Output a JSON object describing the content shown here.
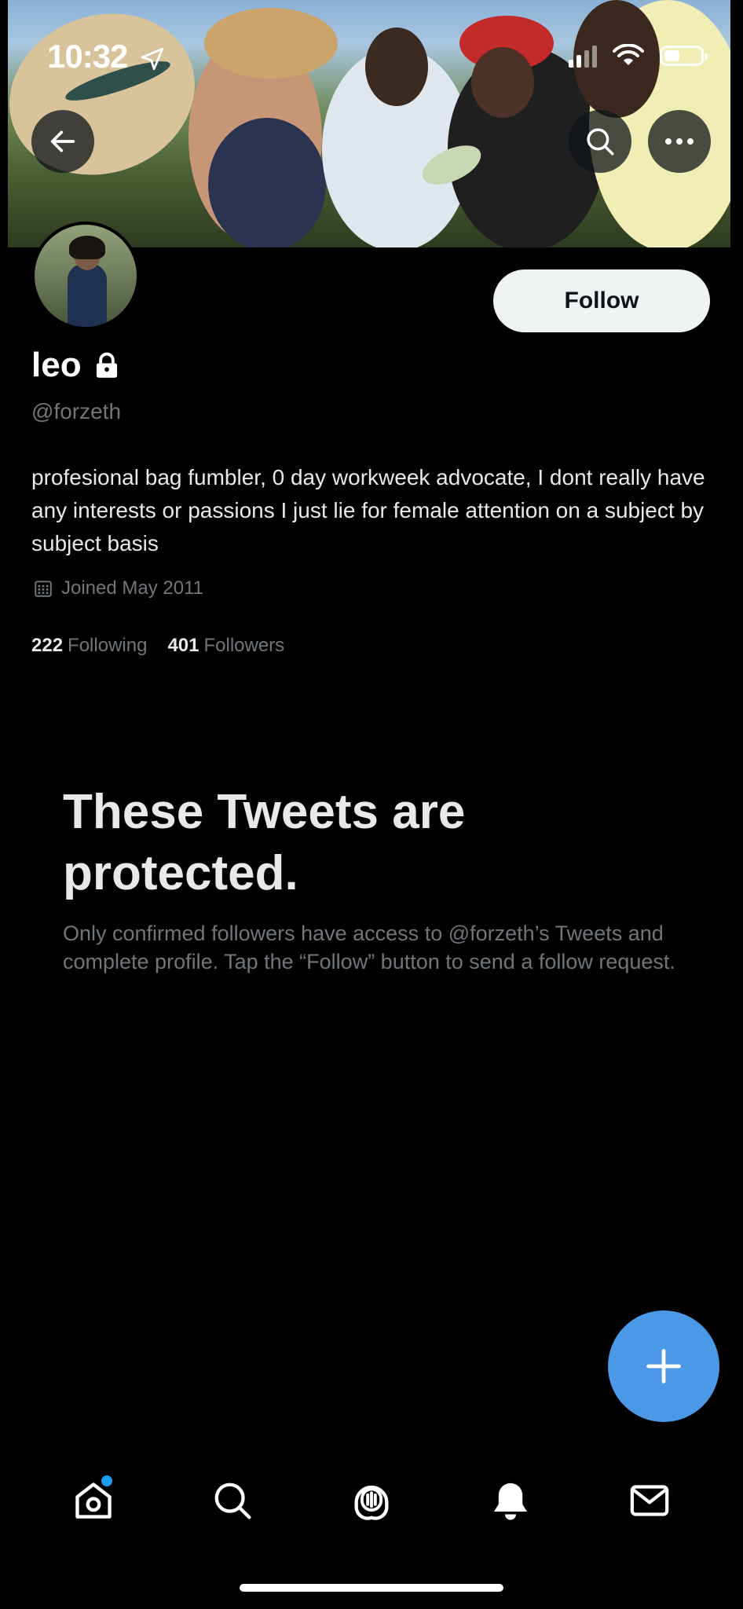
{
  "status_bar": {
    "time": "10:32"
  },
  "profile": {
    "name": "leo",
    "handle": "@forzeth",
    "bio": "profesional bag fumbler, 0 day workweek advocate, I dont really have any interests or passions I just lie for female attention on a subject by subject basis",
    "joined": "Joined May 2011",
    "following_count": "222",
    "following_label": "Following",
    "followers_count": "401",
    "followers_label": "Followers",
    "follow_button": "Follow"
  },
  "protected": {
    "title": "These Tweets are protected.",
    "description": "Only confirmed followers have access to @forzeth’s Tweets and complete profile. Tap the “Follow” button to send a follow request."
  },
  "colors": {
    "accent": "#1d9bf0",
    "fab": "#4b98e6",
    "background": "#000000",
    "secondary_text": "#71767b"
  },
  "icons": [
    "back-arrow-icon",
    "search-icon",
    "more-icon",
    "lock-icon",
    "calendar-icon",
    "compose-plus-icon",
    "home-icon",
    "explore-icon",
    "spaces-icon",
    "notifications-icon",
    "messages-icon"
  ]
}
